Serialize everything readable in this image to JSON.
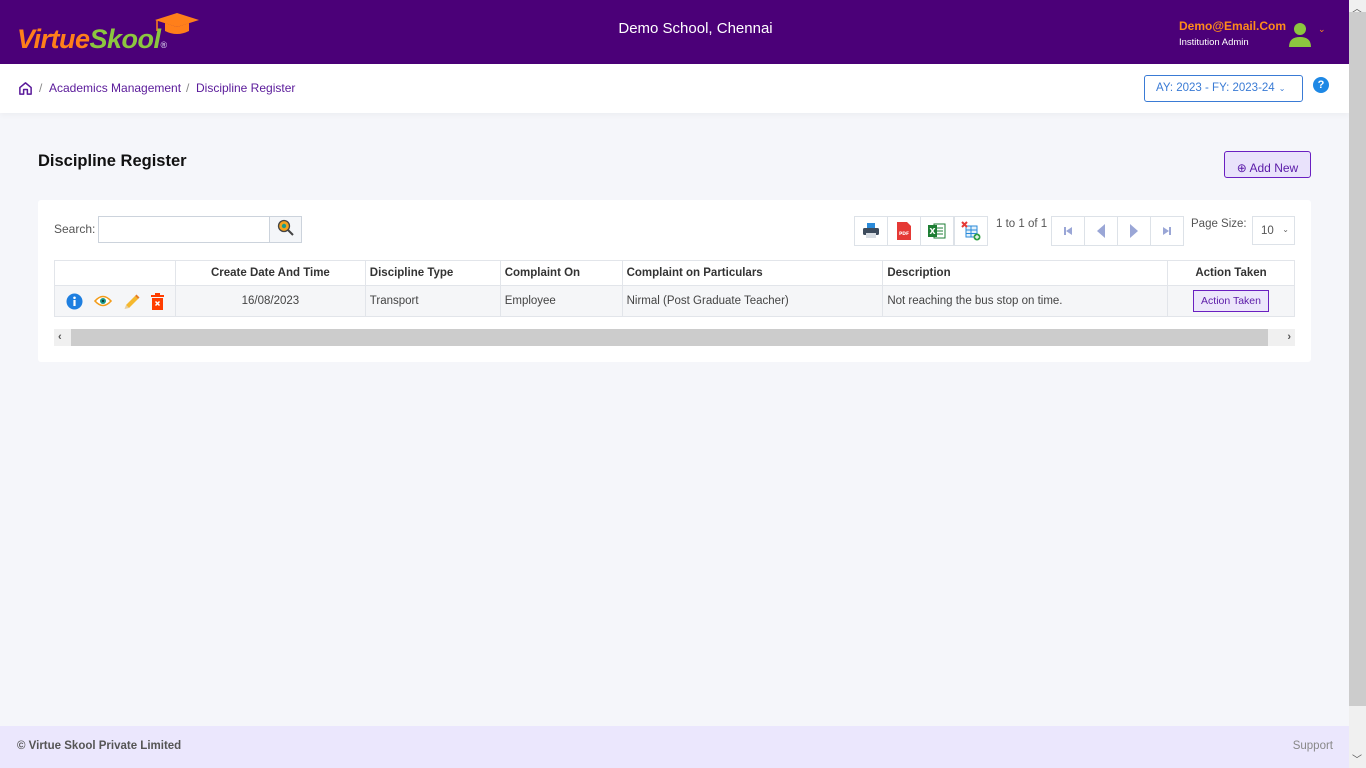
{
  "header": {
    "logo": {
      "part1": "Virtue",
      "part2": "Skool",
      "reg": "®"
    },
    "school_name": "Demo School, Chennai",
    "user": {
      "email": "Demo@Email.Com",
      "role": "Institution Admin",
      "caret": "⌄"
    },
    "colors": {
      "bar": "#4b0078",
      "accent_orange": "#ff7f1a",
      "accent_green": "#8cc63f"
    }
  },
  "breadcrumb": {
    "items": [
      "Academics Management",
      "Discipline Register"
    ],
    "separator": "/"
  },
  "year_selector": {
    "value": "AY: 2023 - FY: 2023-24",
    "caret": "⌄"
  },
  "help": {
    "label": "?"
  },
  "page": {
    "title": "Discipline Register",
    "add_new_label": "⊕ Add New"
  },
  "grid": {
    "search": {
      "label": "Search:",
      "value": "",
      "placeholder": ""
    },
    "exports": [
      "print",
      "pdf",
      "excel",
      "clear-filter"
    ],
    "row_count": "1 to 1 of 1",
    "page_size": {
      "label": "Page Size:",
      "value": "10",
      "caret": "⌄"
    },
    "columns": [
      "",
      "Create Date And Time",
      "Discipline Type",
      "Complaint On",
      "Complaint on Particulars",
      "Description",
      "Action Taken"
    ],
    "rows": [
      {
        "create_date": "16/08/2023",
        "discipline_type": "Transport",
        "complaint_on": "Employee",
        "particulars": "Nirmal (Post Graduate Teacher)",
        "description": "Not reaching the bus stop on time.",
        "action_label": "Action Taken"
      }
    ],
    "scroll": {
      "left": "‹",
      "right": "›"
    }
  },
  "footer": {
    "copyright": "© Virtue Skool Private Limited",
    "support": "Support"
  },
  "scrollbar": {
    "up": "︿",
    "down": "﹀"
  }
}
